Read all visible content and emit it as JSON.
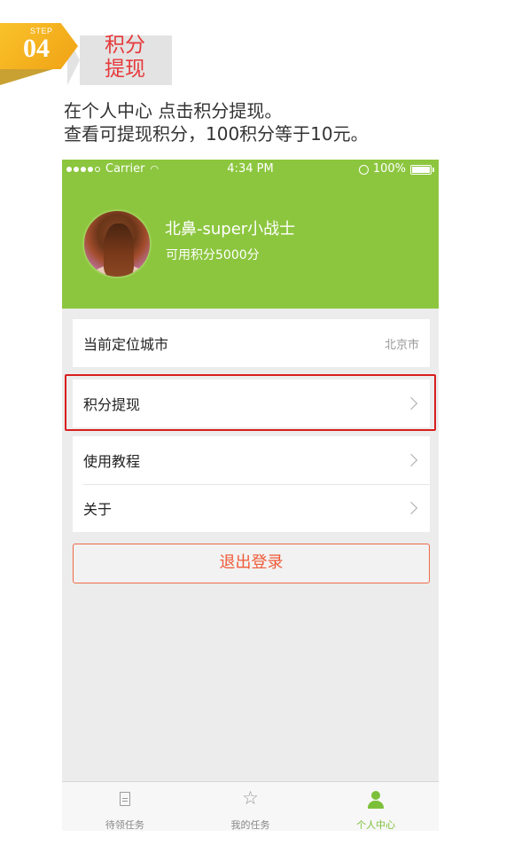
{
  "step": {
    "word": "STEP",
    "number": "04",
    "title_line1": "积分",
    "title_line2": "提现"
  },
  "instructions": {
    "line1": "在个人中心  点击积分提现。",
    "line2": "查看可提现积分，100积分等于10元。"
  },
  "statusbar": {
    "carrier": "Carrier",
    "time": "4:34 PM",
    "battery": "100%"
  },
  "profile": {
    "username": "北鼻-super小战士",
    "points_text": "可用积分5000分"
  },
  "menu": {
    "location_label": "当前定位城市",
    "location_value": "北京市",
    "withdraw_label": "积分提现",
    "tutorial_label": "使用教程",
    "about_label": "关于"
  },
  "logout_label": "退出登录",
  "tabbar": {
    "tabs": [
      {
        "label": "待领任务",
        "icon": "document-icon"
      },
      {
        "label": "我的任务",
        "icon": "star-icon"
      },
      {
        "label": "个人中心",
        "icon": "user-icon",
        "active": true
      }
    ]
  },
  "colors": {
    "header_green": "#8cc63f",
    "highlight_red": "#d81e1e",
    "logout_orange": "#ef5a37",
    "step_red": "#e7393b",
    "step_orange": "#f0a214",
    "active_tab": "#7cc03a"
  }
}
